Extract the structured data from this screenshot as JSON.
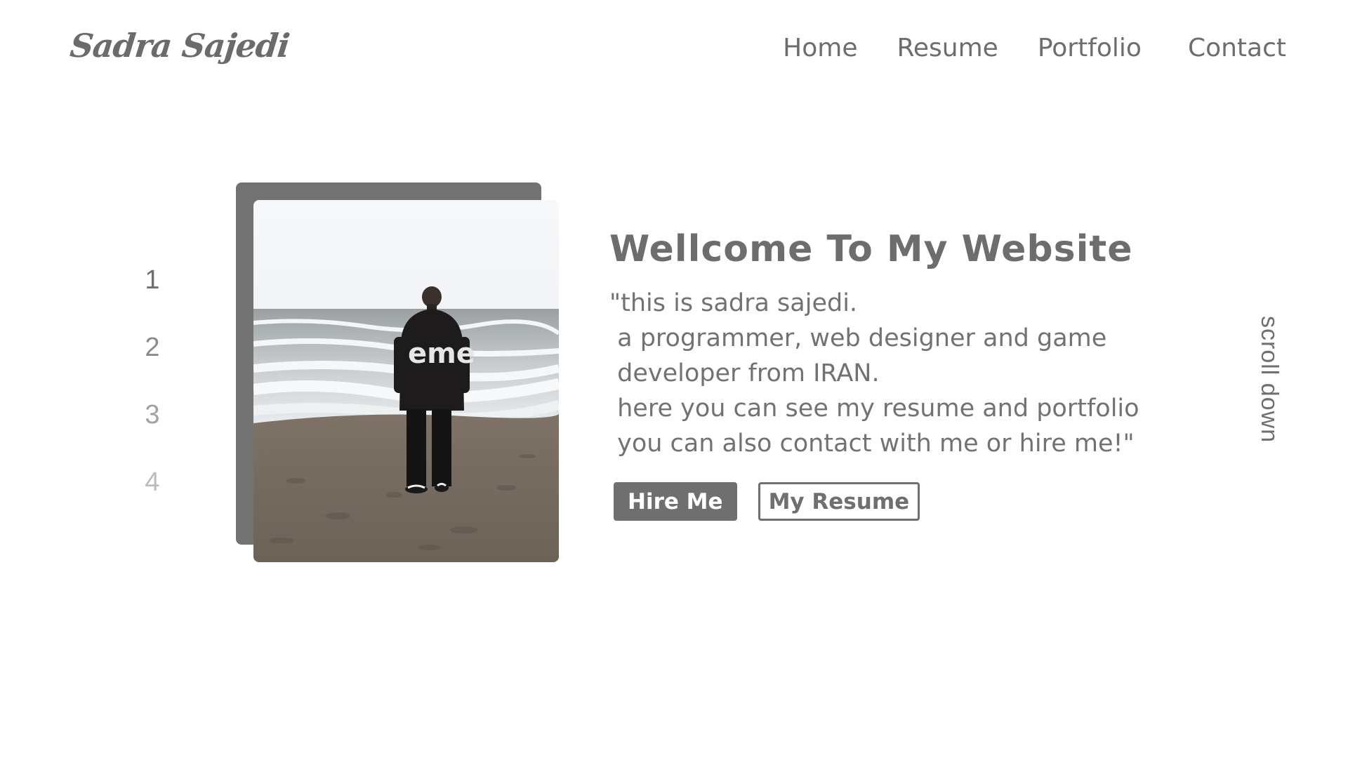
{
  "header": {
    "logo": "Sadra Sajedi",
    "nav": [
      "Home",
      "Resume",
      "Portfolio",
      "Contact"
    ]
  },
  "pager": [
    "1",
    "2",
    "3",
    "4"
  ],
  "hero": {
    "title": "Wellcome To My Website",
    "description": "\"this is sadra sajedi.\n a programmer, web designer and game\n developer from IRAN.\n here you can see my resume and portfolio\n you can also contact with me or hire me!\"",
    "buttons": {
      "hire": "Hire Me",
      "resume": "My Resume"
    }
  },
  "scroll_hint": "scroll down",
  "photo": {
    "hoodie_text": "eme"
  },
  "colors": {
    "primary_gray": "#6f6f6f",
    "background": "#ffffff"
  }
}
